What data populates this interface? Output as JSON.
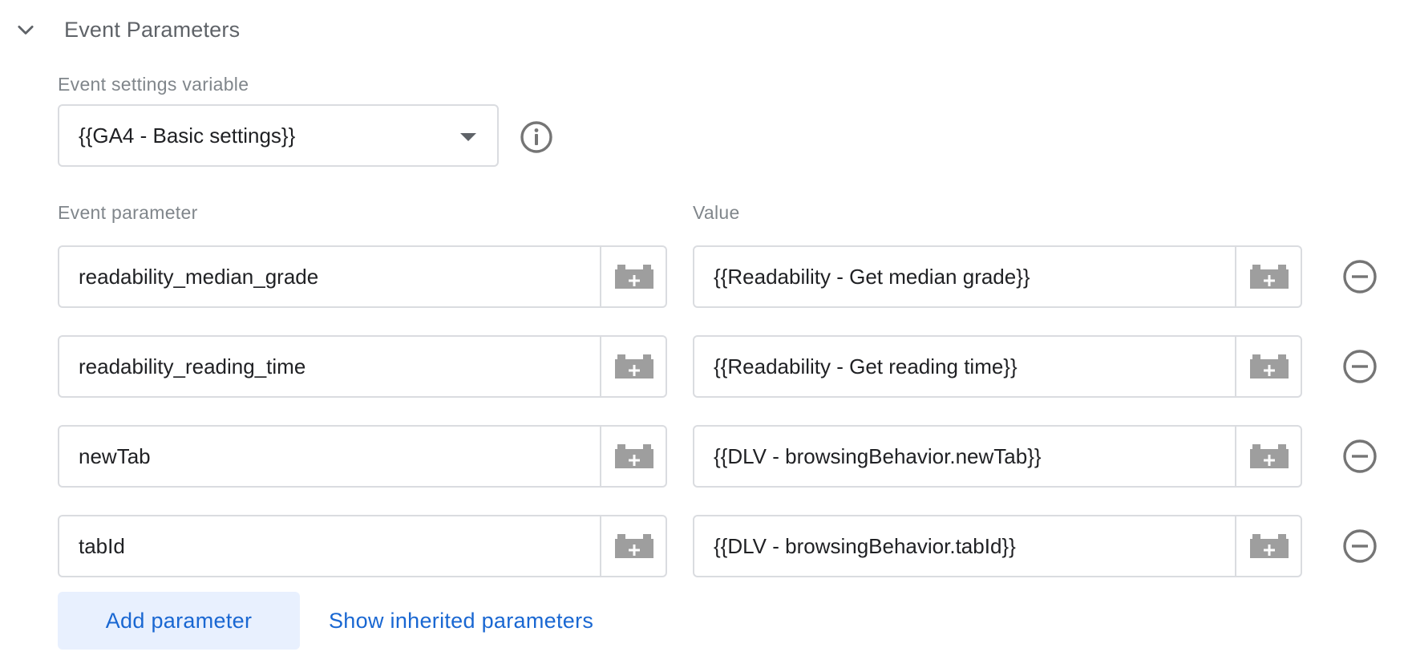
{
  "section": {
    "title": "Event Parameters",
    "expanded_icon": "chevron-down-icon"
  },
  "event_settings": {
    "label": "Event settings variable",
    "selected": "{{GA4 - Basic settings}}",
    "info_icon": "info-icon"
  },
  "columns": {
    "parameter_header": "Event parameter",
    "value_header": "Value"
  },
  "rows": [
    {
      "parameter": "readability_median_grade",
      "value": "{{Readability - Get median grade}}"
    },
    {
      "parameter": "readability_reading_time",
      "value": "{{Readability - Get reading time}}"
    },
    {
      "parameter": "newTab",
      "value": "{{DLV - browsingBehavior.newTab}}"
    },
    {
      "parameter": "tabId",
      "value": "{{DLV - browsingBehavior.tabId}}"
    }
  ],
  "actions": {
    "add_parameter": "Add parameter",
    "show_inherited": "Show inherited parameters"
  },
  "colors": {
    "accent": "#1967d2",
    "accent_bg": "#e8f0fe",
    "border": "#dadce0",
    "icon_gray": "#9e9e9e"
  }
}
